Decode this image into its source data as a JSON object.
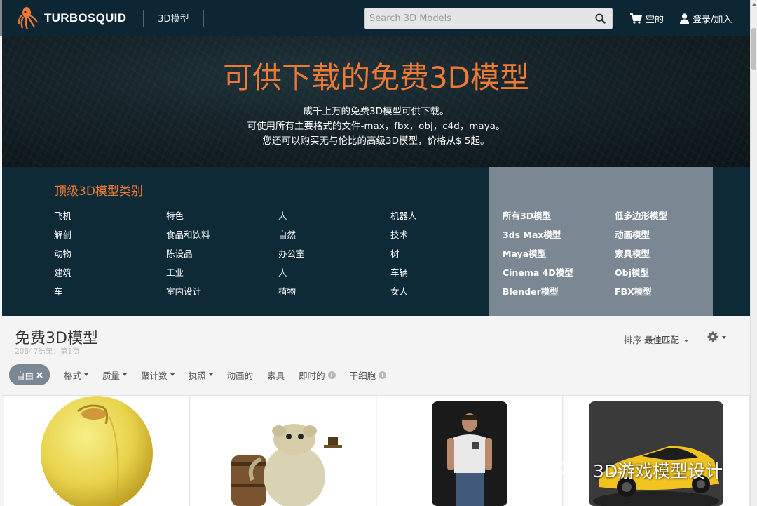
{
  "nav": {
    "brand": "TURBOSQUID",
    "link_3d": "3D模型",
    "search_placeholder": "Search 3D Models",
    "cart_label": "空的",
    "login_label": "登录/加入"
  },
  "hero": {
    "title": "可供下载的免费3D模型",
    "lines": [
      "成千上万的免费3D模型可供下载。",
      "可使用所有主要格式的文件-max，fbx，obj，c4d，maya。",
      "您还可以购买无与伦比的高级3D模型，价格从$ 5起。"
    ]
  },
  "categories": {
    "title": "顶级3D模型类别",
    "columns": [
      [
        "飞机",
        "解剖",
        "动物",
        "建筑",
        "车"
      ],
      [
        "特色",
        "食品和饮料",
        "陈设品",
        "工业",
        "室内设计"
      ],
      [
        "人",
        "自然",
        "办公室",
        "人",
        "植物"
      ],
      [
        "机器人",
        "技术",
        "树",
        "车辆",
        "女人"
      ]
    ],
    "formats": [
      [
        "所有3D模型",
        "3ds Max模型",
        "Maya模型",
        "Cinema 4D模型",
        "Blender模型"
      ],
      [
        "低多边形模型",
        "动画模型",
        "索具模型",
        "Obj模型",
        "FBX模型"
      ]
    ]
  },
  "results": {
    "title": "免费3D模型",
    "count": "20847结果：第1页",
    "sort_prefix": "排序",
    "sort_value": "最佳匹配",
    "active_chip": "自由",
    "filters": [
      {
        "label": "格式",
        "dropdown": true,
        "info": false
      },
      {
        "label": "质量",
        "dropdown": true,
        "info": false
      },
      {
        "label": "聚计数",
        "dropdown": true,
        "info": false
      },
      {
        "label": "执照",
        "dropdown": true,
        "info": false
      },
      {
        "label": "动画的",
        "dropdown": false,
        "info": false
      },
      {
        "label": "索具",
        "dropdown": false,
        "info": false
      },
      {
        "label": "即时的",
        "dropdown": false,
        "info": true
      },
      {
        "label": "干细胞",
        "dropdown": false,
        "info": true
      }
    ]
  },
  "watermark": "3D游戏模型设计",
  "colors": {
    "nav_bg": "#0c2733",
    "accent_orange": "#ee7a35",
    "category_bg": "#0d2a36",
    "formats_bg": "#7b8793",
    "chip_bg": "#7b8793"
  }
}
